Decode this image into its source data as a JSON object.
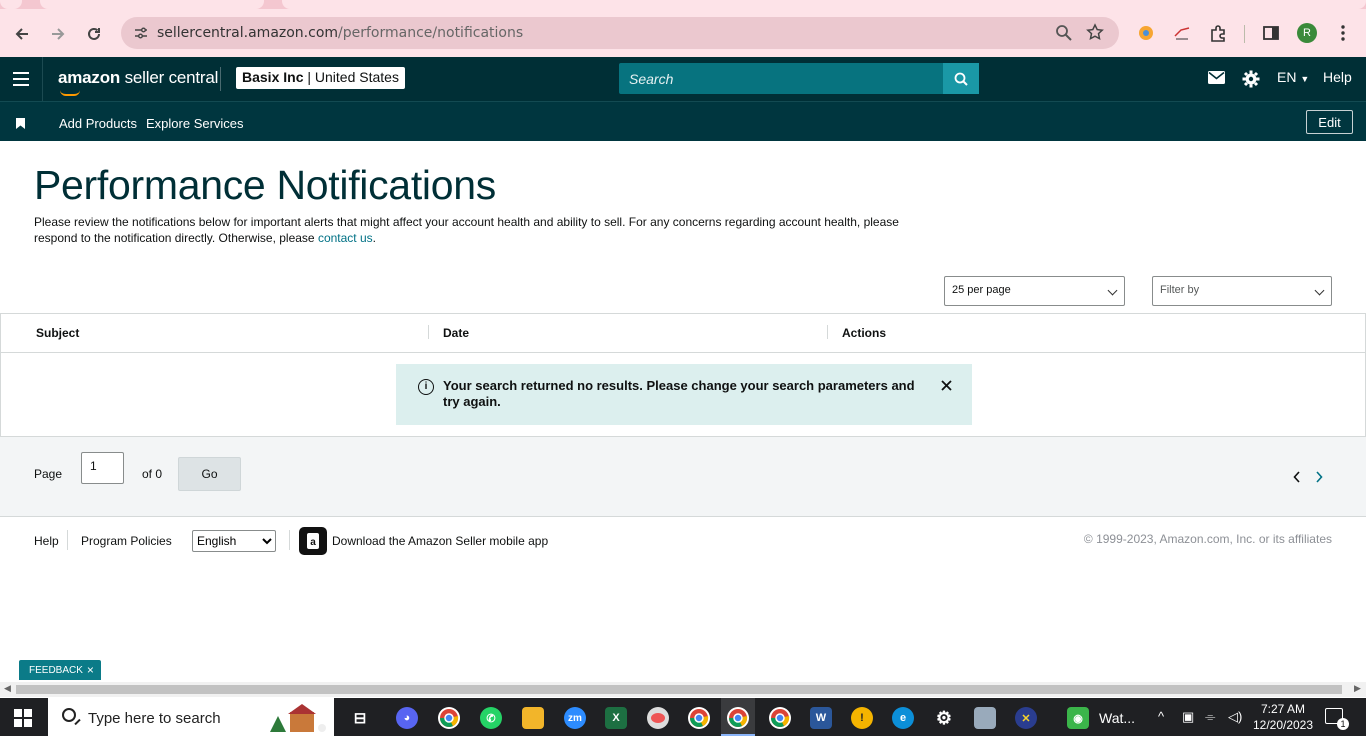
{
  "browser": {
    "url_host": "sellercentral.amazon.com",
    "url_path": "/performance/notifications",
    "profile_initial": "R"
  },
  "header": {
    "logo_bold": "amazon",
    "logo_rest": " seller central",
    "account_name": "Basix Inc",
    "account_region": "United States",
    "search_placeholder": "Search",
    "language": "EN",
    "help_label": "Help"
  },
  "nav": {
    "items": [
      "Add Products",
      "Explore Services"
    ],
    "edit_label": "Edit"
  },
  "page": {
    "title": "Performance Notifications",
    "intro_text": "Please review the notifications below for important alerts that might affect your account health and ability to sell. For any concerns regarding account health, please respond to the notification directly. Otherwise, please ",
    "intro_link": "contact us",
    "intro_end": ".",
    "per_page": "25 per page",
    "filter_placeholder": "Filter by"
  },
  "table": {
    "columns": [
      "Subject",
      "Date",
      "Actions"
    ],
    "empty_message": "Your search returned no results. Please change your search parameters and try again."
  },
  "pager": {
    "page_label": "Page",
    "page_value": "1",
    "of_label": "of 0",
    "go_label": "Go"
  },
  "footer": {
    "links": [
      "Help",
      "Program Policies"
    ],
    "language_selected": "English",
    "app_text": "Download the Amazon Seller mobile app",
    "copyright": "© 1999-2023, Amazon.com, Inc. or its affiliates"
  },
  "feedback": {
    "label": "FEEDBACK",
    "close": "×"
  },
  "taskbar": {
    "search_text": "Type here to search",
    "app_label": "Wat...",
    "time": "7:27 AM",
    "date": "12/20/2023",
    "notification_count": "1"
  },
  "colors": {
    "header_bg": "#002f36",
    "nav_bg": "#00363f",
    "search_bg": "#07737f",
    "link": "#007185",
    "alert_bg": "#dcefee",
    "browser_bg": "#fde3e8"
  }
}
